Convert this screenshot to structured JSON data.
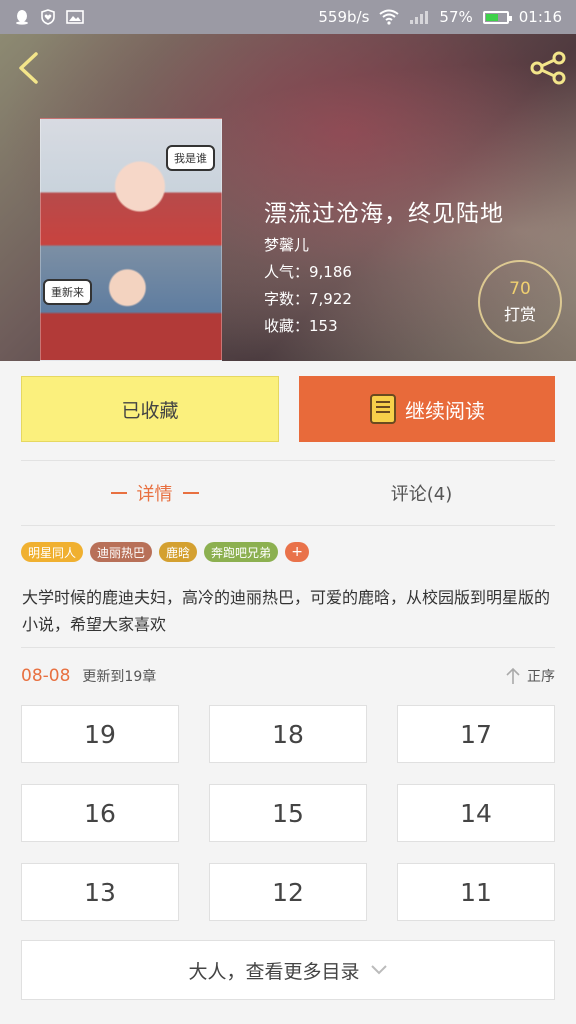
{
  "status_bar": {
    "net_speed": "559b/s",
    "battery": "57%",
    "battery_level": 0.57,
    "time": "01:16",
    "icons": [
      "qq-icon",
      "heart-shield-icon",
      "image-icon",
      "wifi-icon",
      "signal-icon",
      "battery-icon"
    ]
  },
  "header": {
    "back_icon": "chevron-left-icon",
    "share_icon": "share-icon"
  },
  "book": {
    "title": "漂流过沧海，终见陆地",
    "author": "梦馨儿",
    "popularity": "人气：9,186",
    "word_count": "字数：7,922",
    "favorites": "收藏：153",
    "reward_count": "70",
    "reward_label": "打赏",
    "cover_stickers": [
      "我是谁",
      "重新来"
    ]
  },
  "actions": {
    "collected_label": "已收藏",
    "read_label": "继续阅读"
  },
  "tabs": {
    "details": "详情",
    "comments": "评论(4)"
  },
  "tags": [
    {
      "label": "明星同人",
      "color": "#f0b030"
    },
    {
      "label": "迪丽热巴",
      "color": "#b87058"
    },
    {
      "label": "鹿晗",
      "color": "#d4a030"
    },
    {
      "label": "奔跑吧兄弟",
      "color": "#8cb050"
    }
  ],
  "description": "大学时候的鹿迪夫妇，高冷的迪丽热巴，可爱的鹿晗，从校园版到明星版的小说，希望大家喜欢",
  "update": {
    "date": "08-08",
    "text": "更新到19章",
    "order_label": "正序"
  },
  "chapters": [
    "19",
    "18",
    "17",
    "16",
    "15",
    "14",
    "13",
    "12",
    "11"
  ],
  "more_label": "大人，查看更多目录",
  "colors": {
    "accent": "#e87040",
    "collected_bg": "#fbf07d",
    "read_bg": "#e86a3a"
  }
}
